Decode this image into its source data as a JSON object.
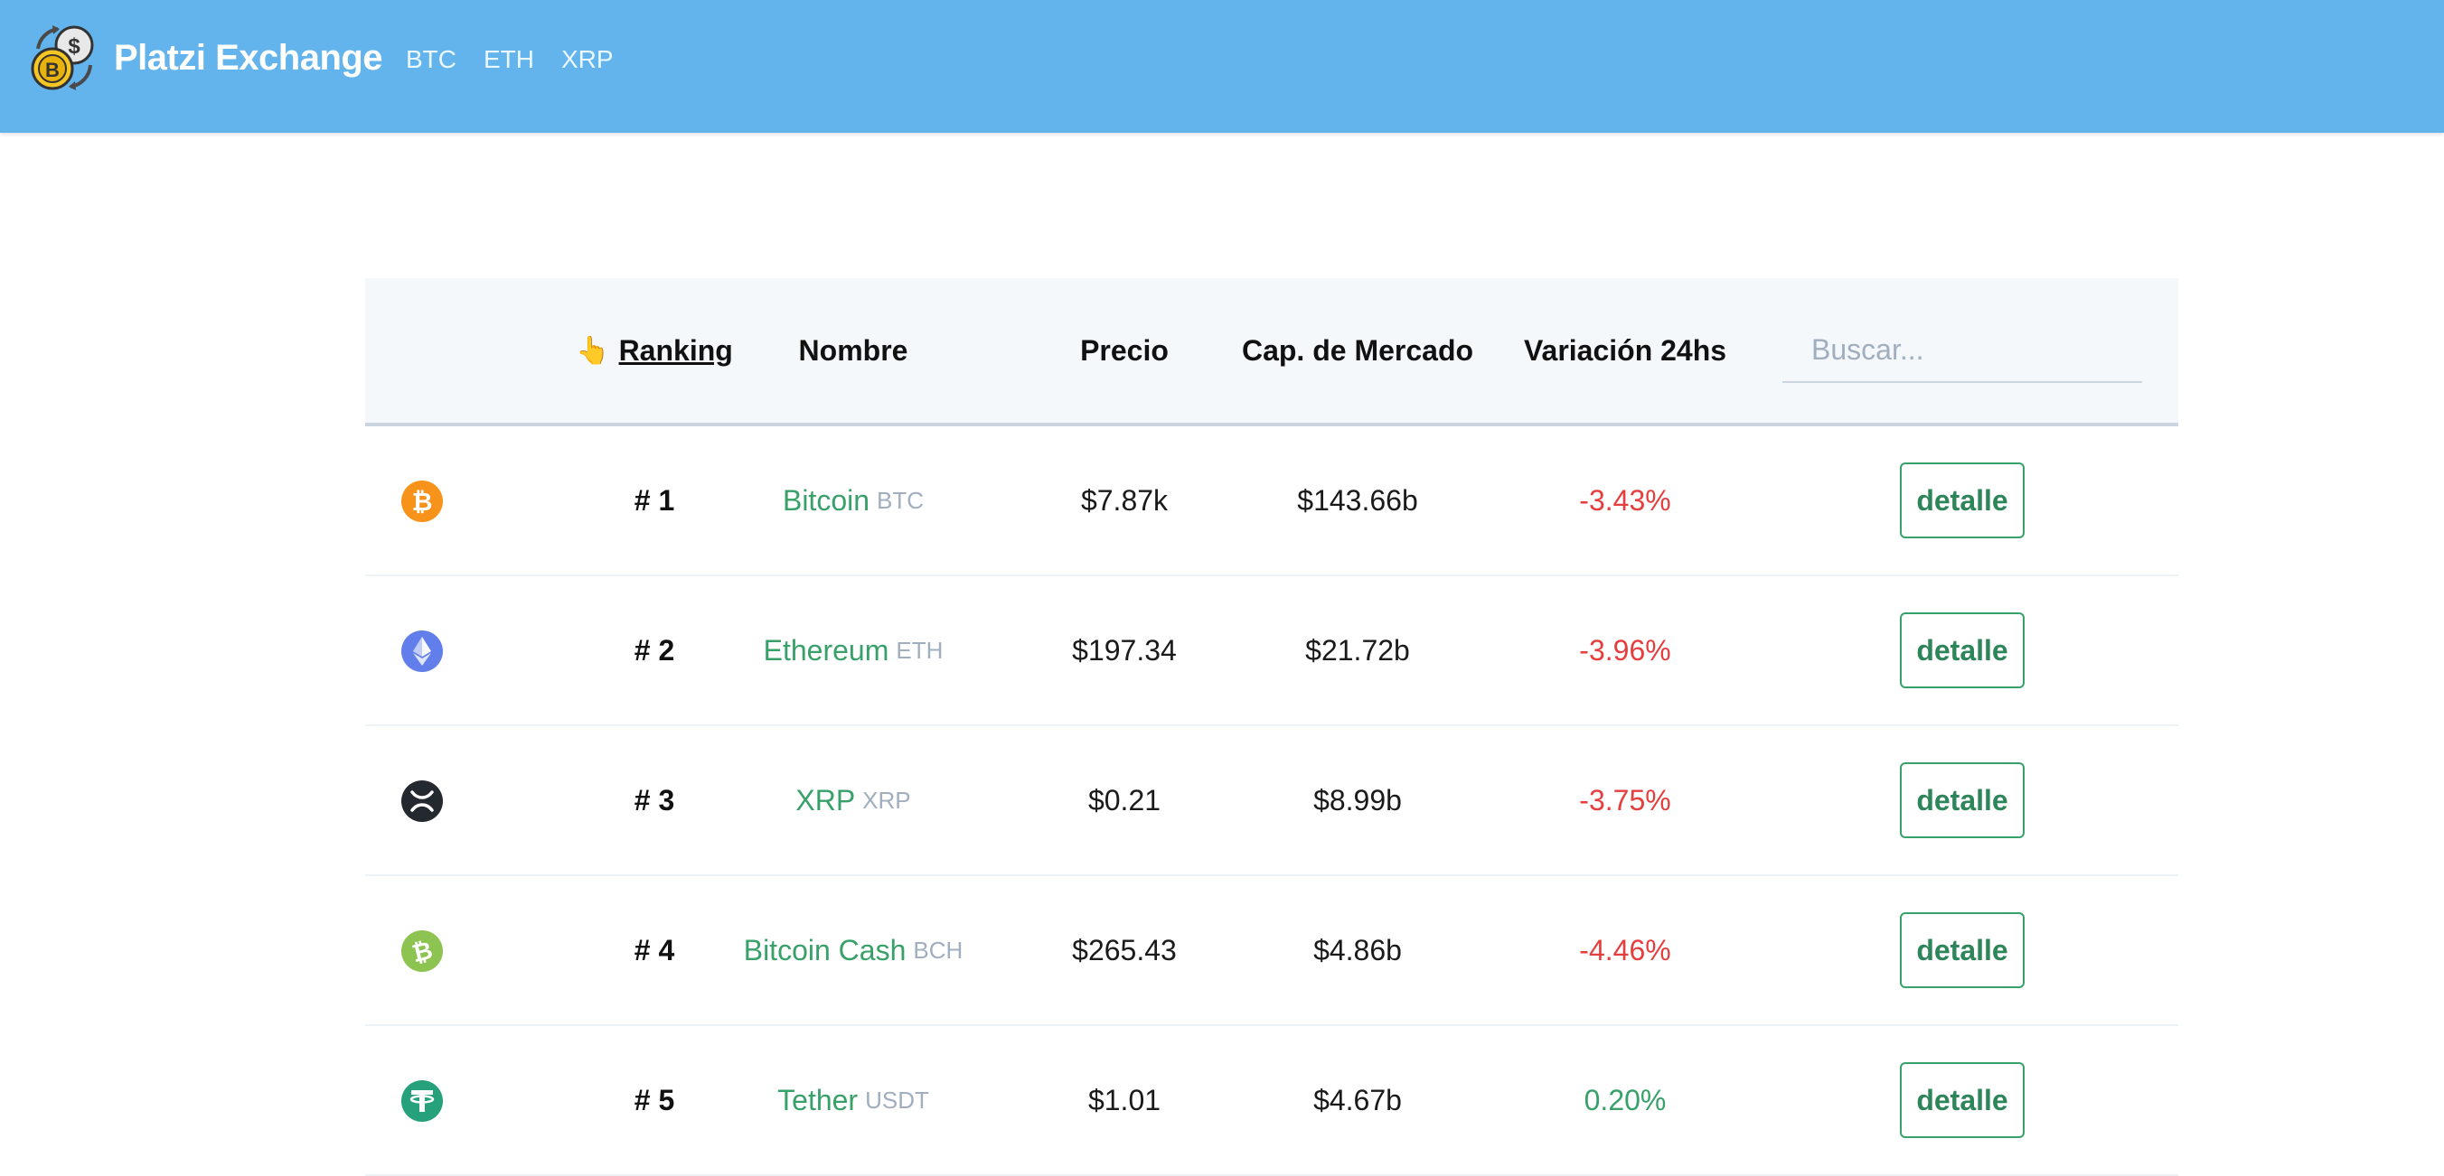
{
  "header": {
    "brand": "Platzi Exchange",
    "nav": [
      "BTC",
      "ETH",
      "XRP"
    ],
    "color": "#63b3ed"
  },
  "table": {
    "columns": {
      "ranking": "Ranking",
      "ranking_icon": "👆",
      "name": "Nombre",
      "price": "Precio",
      "market_cap": "Cap. de Mercado",
      "change": "Variación 24hs"
    },
    "search_placeholder": "Buscar...",
    "detail_label": "detalle",
    "rows": [
      {
        "icon": "bitcoin-icon",
        "color": "#f7931a",
        "rank": "# 1",
        "name": "Bitcoin",
        "symbol": "BTC",
        "price": "$7.87k",
        "market_cap": "$143.66b",
        "change": "-3.43%",
        "trend": "neg"
      },
      {
        "icon": "ethereum-icon",
        "color": "#627eea",
        "rank": "# 2",
        "name": "Ethereum",
        "symbol": "ETH",
        "price": "$197.34",
        "market_cap": "$21.72b",
        "change": "-3.96%",
        "trend": "neg"
      },
      {
        "icon": "xrp-icon",
        "color": "#23292f",
        "rank": "# 3",
        "name": "XRP",
        "symbol": "XRP",
        "price": "$0.21",
        "market_cap": "$8.99b",
        "change": "-3.75%",
        "trend": "neg"
      },
      {
        "icon": "bitcoin-cash-icon",
        "color": "#8dc351",
        "rank": "# 4",
        "name": "Bitcoin Cash",
        "symbol": "BCH",
        "price": "$265.43",
        "market_cap": "$4.86b",
        "change": "-4.46%",
        "trend": "neg"
      },
      {
        "icon": "tether-icon",
        "color": "#26a17b",
        "rank": "# 5",
        "name": "Tether",
        "symbol": "USDT",
        "price": "$1.01",
        "market_cap": "$4.67b",
        "change": "0.20%",
        "trend": "pos"
      }
    ]
  }
}
